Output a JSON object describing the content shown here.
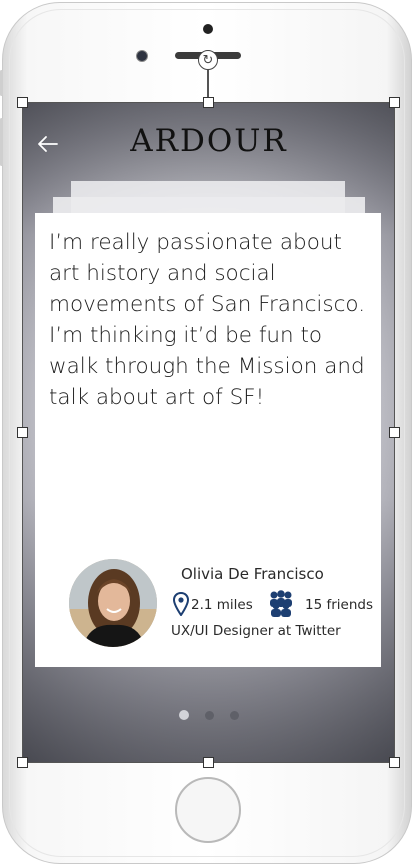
{
  "app": {
    "brand": "ARDOUR"
  },
  "card": {
    "quote": "I’m really passionate about art history and social movements of San Francisco. I’m thinking it’d be fun to walk through the Mission and talk about art of SF!",
    "profile": {
      "name": "Olivia De Francisco",
      "distance": "2.1 miles",
      "friends": "15 friends",
      "role": "UX/UI Designer at Twitter"
    }
  },
  "pagination": {
    "current": 1,
    "total": 3
  },
  "icons": [
    "back-arrow-icon",
    "location-pin-icon",
    "friends-group-icon",
    "rotate-icon"
  ],
  "colors": {
    "accent": "#1d3f72",
    "screen_dark": "#4d4e56",
    "card": "#ffffff"
  }
}
